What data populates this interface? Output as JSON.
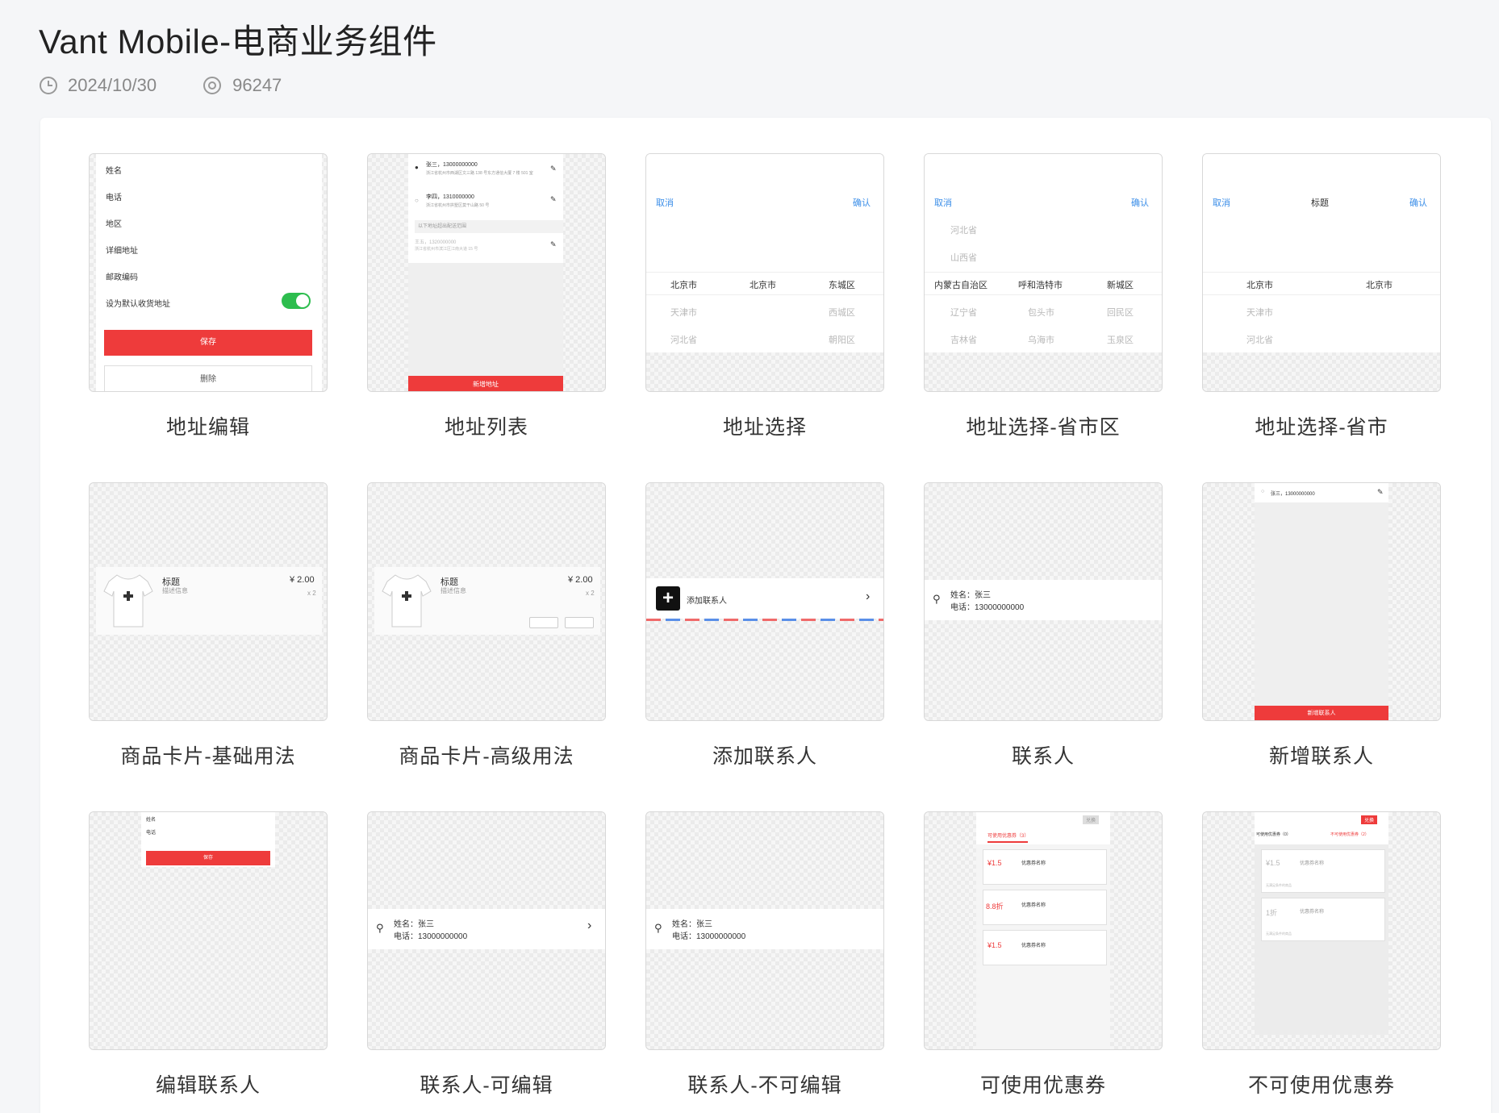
{
  "header": {
    "title": "Vant Mobile-电商业务组件",
    "date": "2024/10/30",
    "views": "96247"
  },
  "colors": {
    "accent_red": "#ee3b3b",
    "link_blue": "#3b8ee8",
    "switch_green": "#2dbd4e"
  },
  "cards": [
    {
      "caption": "地址编辑"
    },
    {
      "caption": "地址列表"
    },
    {
      "caption": "地址选择"
    },
    {
      "caption": "地址选择-省市区"
    },
    {
      "caption": "地址选择-省市"
    },
    {
      "caption": "商品卡片-基础用法"
    },
    {
      "caption": "商品卡片-高级用法"
    },
    {
      "caption": "添加联系人"
    },
    {
      "caption": "联系人"
    },
    {
      "caption": "新增联系人"
    },
    {
      "caption": "编辑联系人"
    },
    {
      "caption": "联系人-可编辑"
    },
    {
      "caption": "联系人-不可编辑"
    },
    {
      "caption": "可使用优惠券"
    },
    {
      "caption": "不可使用优惠券"
    }
  ],
  "address_edit": {
    "fields": [
      "姓名",
      "电话",
      "地区",
      "详细地址",
      "邮政编码"
    ],
    "default_label": "设为默认收货地址",
    "save": "保存",
    "delete": "删除"
  },
  "address_list": {
    "items": [
      {
        "name": "张三，13000000000",
        "addr": "浙江省杭州市西湖区文三路 138 号东方通信大厦 7 楼 501 室"
      },
      {
        "name": "李四，1310000000",
        "addr": "浙江省杭州市拱墅区莫干山路 50 号"
      }
    ],
    "section": "以下地址超出配送范围",
    "disabled": {
      "name": "王五，1320000000",
      "addr": "浙江省杭州市滨江区江南大道 15 号"
    },
    "add": "新增地址"
  },
  "area1": {
    "cancel": "取消",
    "confirm": "确认",
    "col1": [
      "北京市",
      "天津市",
      "河北省"
    ],
    "col2": [
      "北京市"
    ],
    "col3": [
      "东城区",
      "西城区",
      "朝阳区"
    ]
  },
  "area2": {
    "cancel": "取消",
    "confirm": "确认",
    "col1": [
      "河北省",
      "山西省",
      "内蒙古自治区",
      "辽宁省",
      "吉林省"
    ],
    "col2": [
      "呼和浩特市",
      "包头市",
      "乌海市"
    ],
    "col3": [
      "新城区",
      "回民区",
      "玉泉区"
    ]
  },
  "area3": {
    "cancel": "取消",
    "title": "标题",
    "confirm": "确认",
    "col1": [
      "北京市",
      "天津市",
      "河北省"
    ],
    "col2": [
      "北京市"
    ]
  },
  "goods": {
    "title": "标题",
    "desc": "描述信息",
    "price": "¥ 2.00",
    "num": "x 2"
  },
  "add_contact": {
    "label": "添加联系人"
  },
  "contact": {
    "name": "姓名：张三",
    "tel": "电话：13000000000"
  },
  "new_contact": {
    "item": "张三，13000000000",
    "button": "新增联系人"
  },
  "edit_contact": {
    "name": "姓名",
    "tel": "电话",
    "save": "保存"
  },
  "coupon_ok": {
    "exchange": "兑换",
    "tab1": "可使用优惠券（3）",
    "coupons": [
      {
        "value": "¥1.5",
        "name": "优惠券名称"
      },
      {
        "value": "8.8折",
        "name": "优惠券名称"
      },
      {
        "value": "¥1.5",
        "name": "优惠券名称"
      }
    ]
  },
  "coupon_no": {
    "exchange": "兑换",
    "tab1": "可使用优惠券（0）",
    "tab2": "不可使用优惠券（2）",
    "coupons": [
      {
        "value": "¥1.5",
        "name": "优惠券名称",
        "note": "无满足条件的商品"
      },
      {
        "value": "1折",
        "name": "优惠券名称",
        "note": "无满足条件的商品"
      }
    ]
  }
}
